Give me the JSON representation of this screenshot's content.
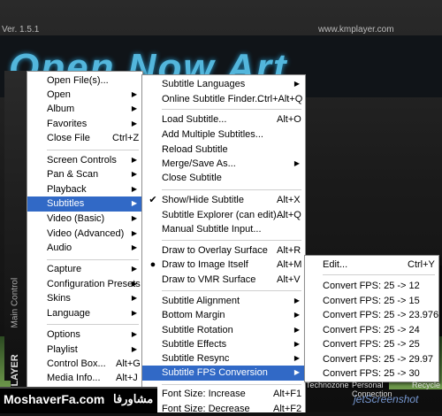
{
  "header": {
    "version": "Ver. 1.5.1",
    "website": "www.kmplayer.com",
    "logo_text": "Open Now Art"
  },
  "sidebar_caption": {
    "brand": "KMPLAYER",
    "section": "Main Control"
  },
  "menu_main": {
    "items": [
      {
        "label": "Open File(s)...",
        "shortcut": "",
        "arrow": false
      },
      {
        "label": "Open",
        "shortcut": "",
        "arrow": true
      },
      {
        "label": "Album",
        "shortcut": "",
        "arrow": true
      },
      {
        "label": "Favorites",
        "shortcut": "",
        "arrow": true
      },
      {
        "label": "Close File",
        "shortcut": "Ctrl+Z",
        "arrow": false
      },
      {
        "label": "Screen Controls",
        "shortcut": "",
        "arrow": true
      },
      {
        "label": "Pan & Scan",
        "shortcut": "",
        "arrow": true
      },
      {
        "label": "Playback",
        "shortcut": "",
        "arrow": true
      },
      {
        "label": "Subtitles",
        "shortcut": "",
        "arrow": true
      },
      {
        "label": "Video (Basic)",
        "shortcut": "",
        "arrow": true
      },
      {
        "label": "Video (Advanced)",
        "shortcut": "",
        "arrow": true
      },
      {
        "label": "Audio",
        "shortcut": "",
        "arrow": true
      },
      {
        "label": "Capture",
        "shortcut": "",
        "arrow": true
      },
      {
        "label": "Configuration Presets",
        "shortcut": "",
        "arrow": true
      },
      {
        "label": "Skins",
        "shortcut": "",
        "arrow": true
      },
      {
        "label": "Language",
        "shortcut": "",
        "arrow": true
      },
      {
        "label": "Options",
        "shortcut": "",
        "arrow": true
      },
      {
        "label": "Playlist",
        "shortcut": "",
        "arrow": true
      },
      {
        "label": "Control Box...",
        "shortcut": "Alt+G",
        "arrow": false
      },
      {
        "label": "Media Info...",
        "shortcut": "Alt+J",
        "arrow": false
      }
    ]
  },
  "menu_subtitles": {
    "items": [
      {
        "label": "Subtitle Languages",
        "shortcut": "",
        "arrow": true,
        "mark": ""
      },
      {
        "label": "Online Subtitle Finder...",
        "shortcut": "Ctrl+Alt+Q",
        "arrow": false,
        "mark": ""
      },
      {
        "label": "Load Subtitle...",
        "shortcut": "Alt+O",
        "arrow": false,
        "mark": ""
      },
      {
        "label": "Add Multiple Subtitles...",
        "shortcut": "",
        "arrow": false,
        "mark": ""
      },
      {
        "label": "Reload Subtitle",
        "shortcut": "",
        "arrow": false,
        "mark": ""
      },
      {
        "label": "Merge/Save As...",
        "shortcut": "",
        "arrow": true,
        "mark": ""
      },
      {
        "label": "Close Subtitle",
        "shortcut": "",
        "arrow": false,
        "mark": ""
      },
      {
        "label": "Show/Hide Subtitle",
        "shortcut": "Alt+X",
        "arrow": false,
        "mark": "✔"
      },
      {
        "label": "Subtitle Explorer (can edit)...",
        "shortcut": "Alt+Q",
        "arrow": false,
        "mark": ""
      },
      {
        "label": "Manual Subtitle Input...",
        "shortcut": "",
        "arrow": false,
        "mark": ""
      },
      {
        "label": "Draw to Overlay Surface",
        "shortcut": "Alt+R",
        "arrow": false,
        "mark": ""
      },
      {
        "label": "Draw to Image Itself",
        "shortcut": "Alt+M",
        "arrow": false,
        "mark": "●"
      },
      {
        "label": "Draw to VMR Surface",
        "shortcut": "Alt+V",
        "arrow": false,
        "mark": ""
      },
      {
        "label": "Subtitle Alignment",
        "shortcut": "",
        "arrow": true,
        "mark": ""
      },
      {
        "label": "Bottom Margin",
        "shortcut": "",
        "arrow": true,
        "mark": ""
      },
      {
        "label": "Subtitle Rotation",
        "shortcut": "",
        "arrow": true,
        "mark": ""
      },
      {
        "label": "Subtitle Effects",
        "shortcut": "",
        "arrow": true,
        "mark": ""
      },
      {
        "label": "Subtitle Resync",
        "shortcut": "",
        "arrow": true,
        "mark": ""
      },
      {
        "label": "Subtitle FPS Conversion",
        "shortcut": "",
        "arrow": true,
        "mark": ""
      },
      {
        "label": "Font Size: Increase",
        "shortcut": "Alt+F1",
        "arrow": false,
        "mark": ""
      },
      {
        "label": "Font Size: Decrease",
        "shortcut": "Alt+F2",
        "arrow": false,
        "mark": ""
      }
    ]
  },
  "menu_fps": {
    "items": [
      {
        "label": "Edit...",
        "shortcut": "Ctrl+Y"
      },
      {
        "label": "Convert FPS: 25 -> 12",
        "shortcut": ""
      },
      {
        "label": "Convert FPS: 25 -> 15",
        "shortcut": ""
      },
      {
        "label": "Convert FPS: 25 -> 23.976",
        "shortcut": ""
      },
      {
        "label": "Convert FPS: 25 -> 24",
        "shortcut": ""
      },
      {
        "label": "Convert FPS: 25 -> 25",
        "shortcut": ""
      },
      {
        "label": "Convert FPS: 25 -> 29.97",
        "shortcut": ""
      },
      {
        "label": "Convert FPS: 25 -> 30",
        "shortcut": ""
      }
    ]
  },
  "footer": {
    "site_latin": "MoshaverFa.com",
    "site_persian": "مشاورفا",
    "bg_label_1": "Technozone",
    "bg_label_2": "Personal Connection",
    "bg_label_3": "Recycle",
    "watermark": "jetScreenshot"
  },
  "colors": {
    "highlight": "#3169c6",
    "logo_glow": "#5fd3ff",
    "footer_bg": "#000000"
  }
}
